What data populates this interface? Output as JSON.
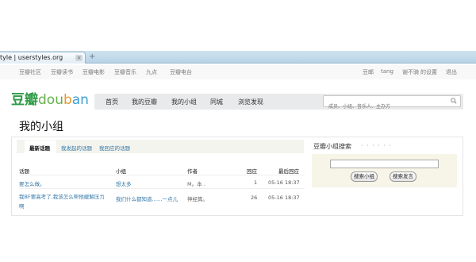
{
  "browser": {
    "tab_title": "tyle | userstyles.org",
    "close_glyph": "×",
    "new_tab_glyph": "+"
  },
  "topnav": {
    "left": [
      "豆瓣社区",
      "豆瓣读书",
      "豆瓣电影",
      "豆瓣音乐",
      "九点",
      "豆瓣电台"
    ],
    "right": [
      "豆邮",
      "tang",
      "谢不骑",
      "的设置",
      "退出"
    ]
  },
  "logo": {
    "cn": "豆瓣",
    "d1": "dou",
    "d2": "b",
    "d3": "an"
  },
  "mainnav": [
    "首页",
    "我的豆瓣",
    "我的小组",
    "同城",
    "浏览发现"
  ],
  "search": {
    "placeholder": "成员、小组、音乐人、主办方"
  },
  "page_title": "我的小组",
  "subtabs": {
    "active": "最新话题",
    "others": [
      "我发起的话题",
      "我回应的话题"
    ]
  },
  "table": {
    "headers": [
      "话题",
      "小组",
      "作者",
      "回应",
      "最后回应"
    ],
    "rows": [
      {
        "topic": "要怎么做。",
        "group": "想太多",
        "author": "M。本 .",
        "replies": "1",
        "last": "05-16 18:37"
      },
      {
        "topic": "我BF要高考了,我该怎么帮他缓解压力",
        "topic2": "啊",
        "group": "我们什么都知道……一点儿",
        "author": "神经箕。",
        "replies": "26",
        "last": "05-16 18:37"
      }
    ]
  },
  "side": {
    "title": "豆瓣小组搜索",
    "dots": "· · · · · ·",
    "search_group_btn": "搜索小组",
    "search_post_btn": "搜索发言"
  },
  "colors": {
    "brand_green": "#2f9b48",
    "link_blue": "#3377aa",
    "nav_bg": "#e9eaeb"
  }
}
